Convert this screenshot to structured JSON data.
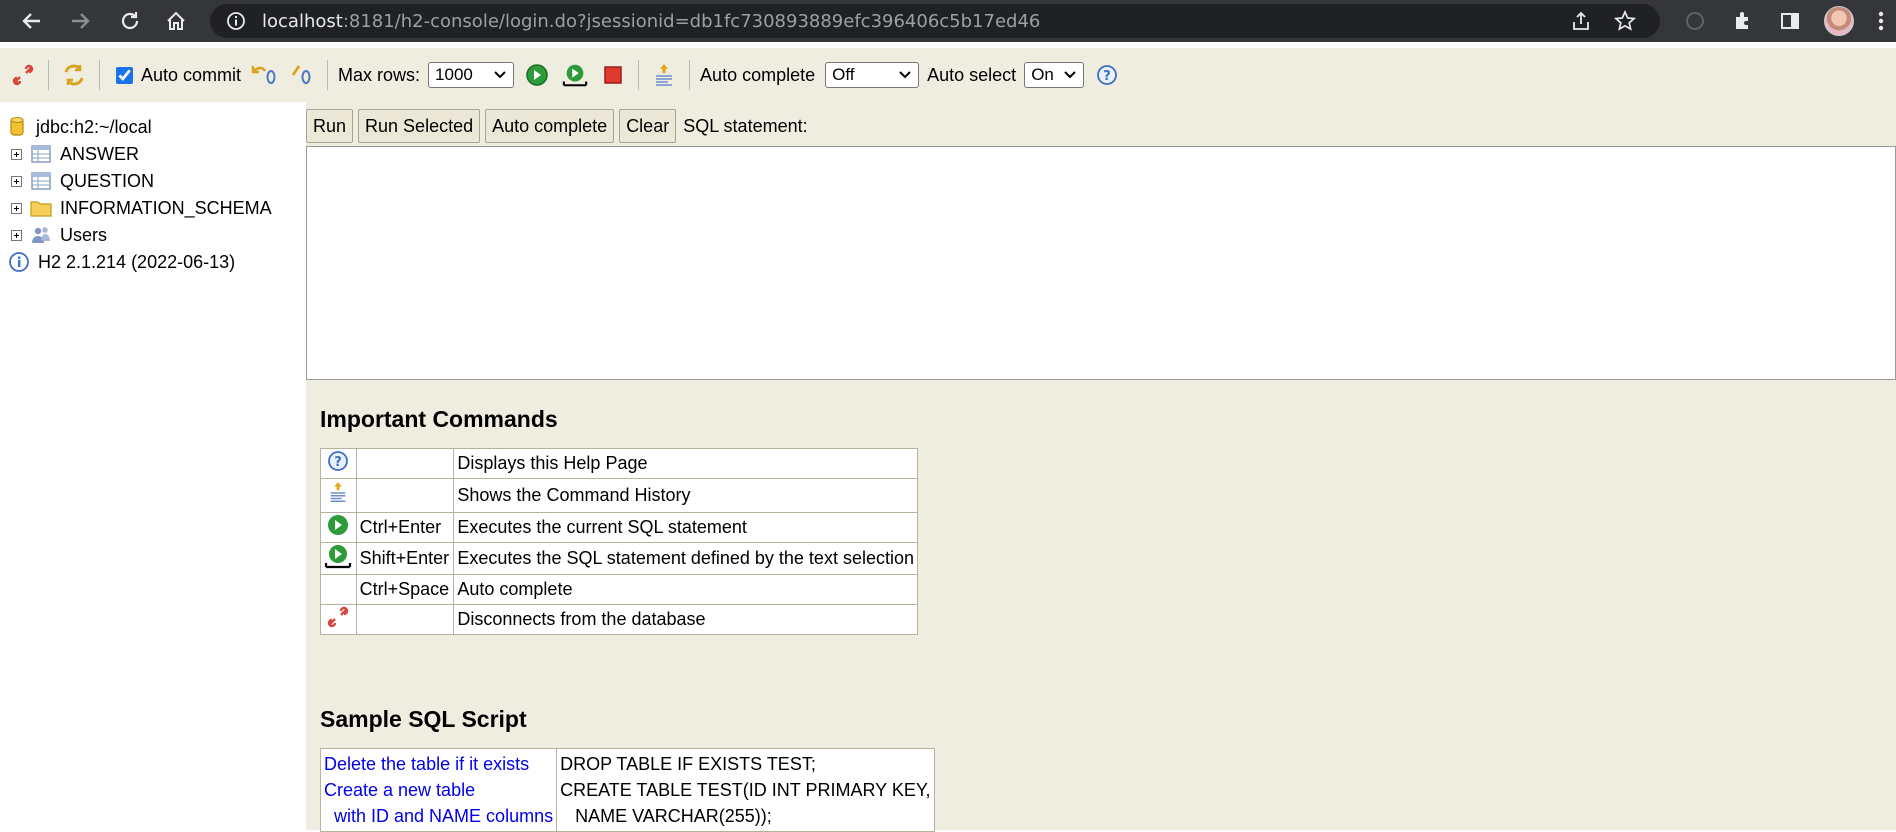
{
  "browser": {
    "url_host": "localhost",
    "url_rest": ":8181/h2-console/login.do?jsessionid=db1fc730893889efc396406c5b17ed46",
    "icons": [
      "back-icon",
      "forward-icon",
      "reload-icon",
      "home-icon",
      "info-icon",
      "share-icon",
      "star-icon",
      "extensions-icon",
      "sidepanel-icon",
      "avatar",
      "menu-icon"
    ]
  },
  "toolbar": {
    "auto_commit_label": "Auto commit",
    "auto_commit_checked": true,
    "max_rows_label": "Max rows:",
    "max_rows_value": "1000",
    "auto_complete_label": "Auto complete",
    "auto_complete_value": "Off",
    "auto_select_label": "Auto select",
    "auto_select_value": "On"
  },
  "tree": {
    "connection": "jdbc:h2:~/local",
    "items": [
      {
        "label": "ANSWER",
        "icon": "table-icon"
      },
      {
        "label": "QUESTION",
        "icon": "table-icon"
      },
      {
        "label": "INFORMATION_SCHEMA",
        "icon": "folder-icon"
      },
      {
        "label": "Users",
        "icon": "users-icon"
      }
    ],
    "version": "H2 2.1.214 (2022-06-13)"
  },
  "query": {
    "run_label": "Run",
    "run_selected_label": "Run Selected",
    "auto_complete_label": "Auto complete",
    "clear_label": "Clear",
    "sql_statement_label": "SQL statement:"
  },
  "help": {
    "important_title": "Important Commands",
    "commands": [
      {
        "icon": "help-icon",
        "key": "",
        "desc": "Displays this Help Page"
      },
      {
        "icon": "history-icon",
        "key": "",
        "desc": "Shows the Command History"
      },
      {
        "icon": "run-icon",
        "key": "Ctrl+Enter",
        "desc": "Executes the current SQL statement"
      },
      {
        "icon": "run-selected-icon",
        "key": "Shift+Enter",
        "desc": "Executes the SQL statement defined by the text selection"
      },
      {
        "icon": "",
        "key": "Ctrl+Space",
        "desc": "Auto complete"
      },
      {
        "icon": "disconnect-icon",
        "key": "",
        "desc": "Disconnects from the database"
      }
    ],
    "sample_title": "Sample SQL Script",
    "sample_rows": [
      {
        "link": "Delete the table if it exists",
        "sql": "DROP TABLE IF EXISTS TEST;"
      },
      {
        "link": "Create a new table",
        "sql": "CREATE TABLE TEST(ID INT PRIMARY KEY,"
      },
      {
        "link": "  with ID and NAME columns",
        "sql": "   NAME VARCHAR(255));"
      }
    ]
  },
  "colors": {
    "panel_bg": "#efece0",
    "chrome_bg": "#35363a",
    "link": "#0000ee"
  }
}
